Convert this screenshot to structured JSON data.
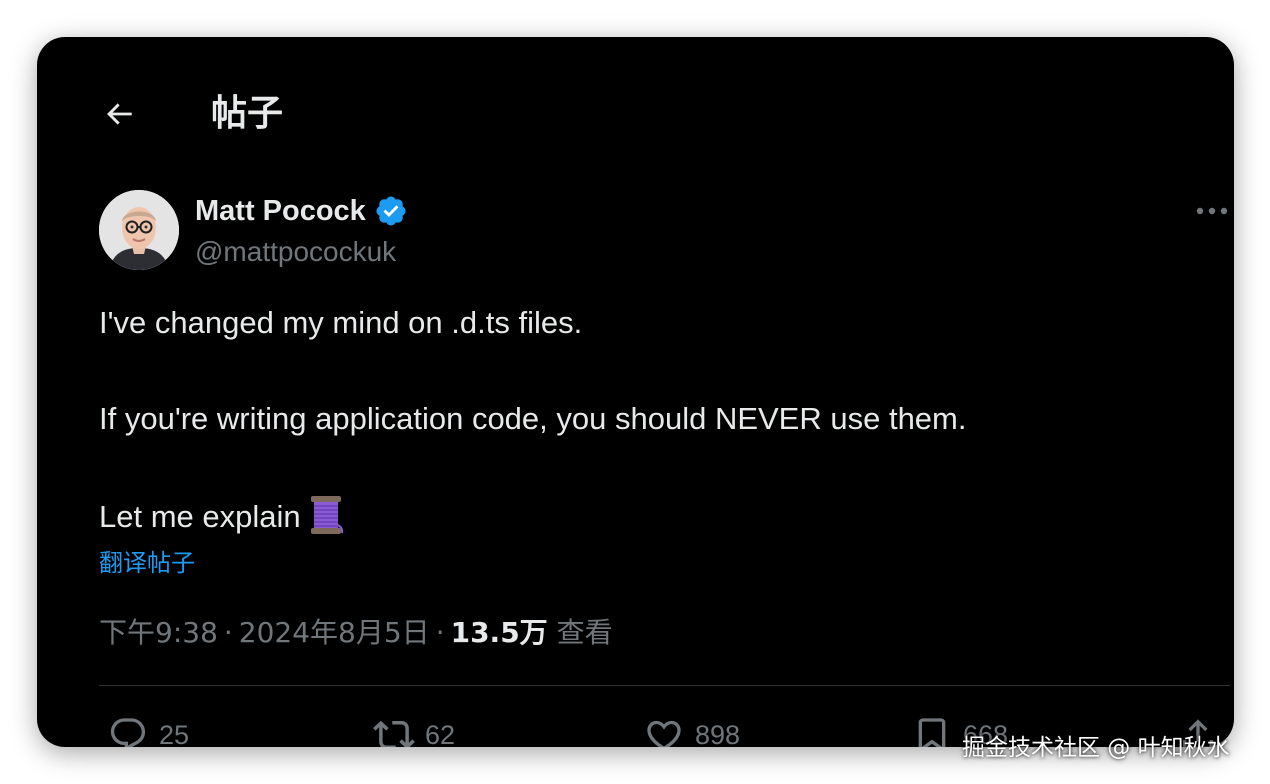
{
  "header": {
    "title": "帖子",
    "back_icon": "arrow-left-icon"
  },
  "author": {
    "name": "Matt Pocock",
    "handle": "@mattpocockuk",
    "verified": true,
    "verified_color": "#1d9bf0"
  },
  "tweet": {
    "lines": [
      "I've changed my mind on .d.ts files.",
      "If you're writing application code, you should NEVER use them.",
      "Let me explain"
    ],
    "emoji": "thread-spool",
    "translate_label": "翻译帖子"
  },
  "meta": {
    "time": "下午9:38",
    "separator": "·",
    "date": "2024年8月5日",
    "views_count": "13.5万",
    "views_label": "查看"
  },
  "actions": {
    "replies": "25",
    "reposts": "62",
    "likes": "898",
    "bookmarks": "668"
  },
  "colors": {
    "background": "#000000",
    "text": "#e7e9ea",
    "secondary": "#71767b",
    "accent": "#1d9bf0"
  },
  "watermark": "掘金技术社区 @ 叶知秋水"
}
